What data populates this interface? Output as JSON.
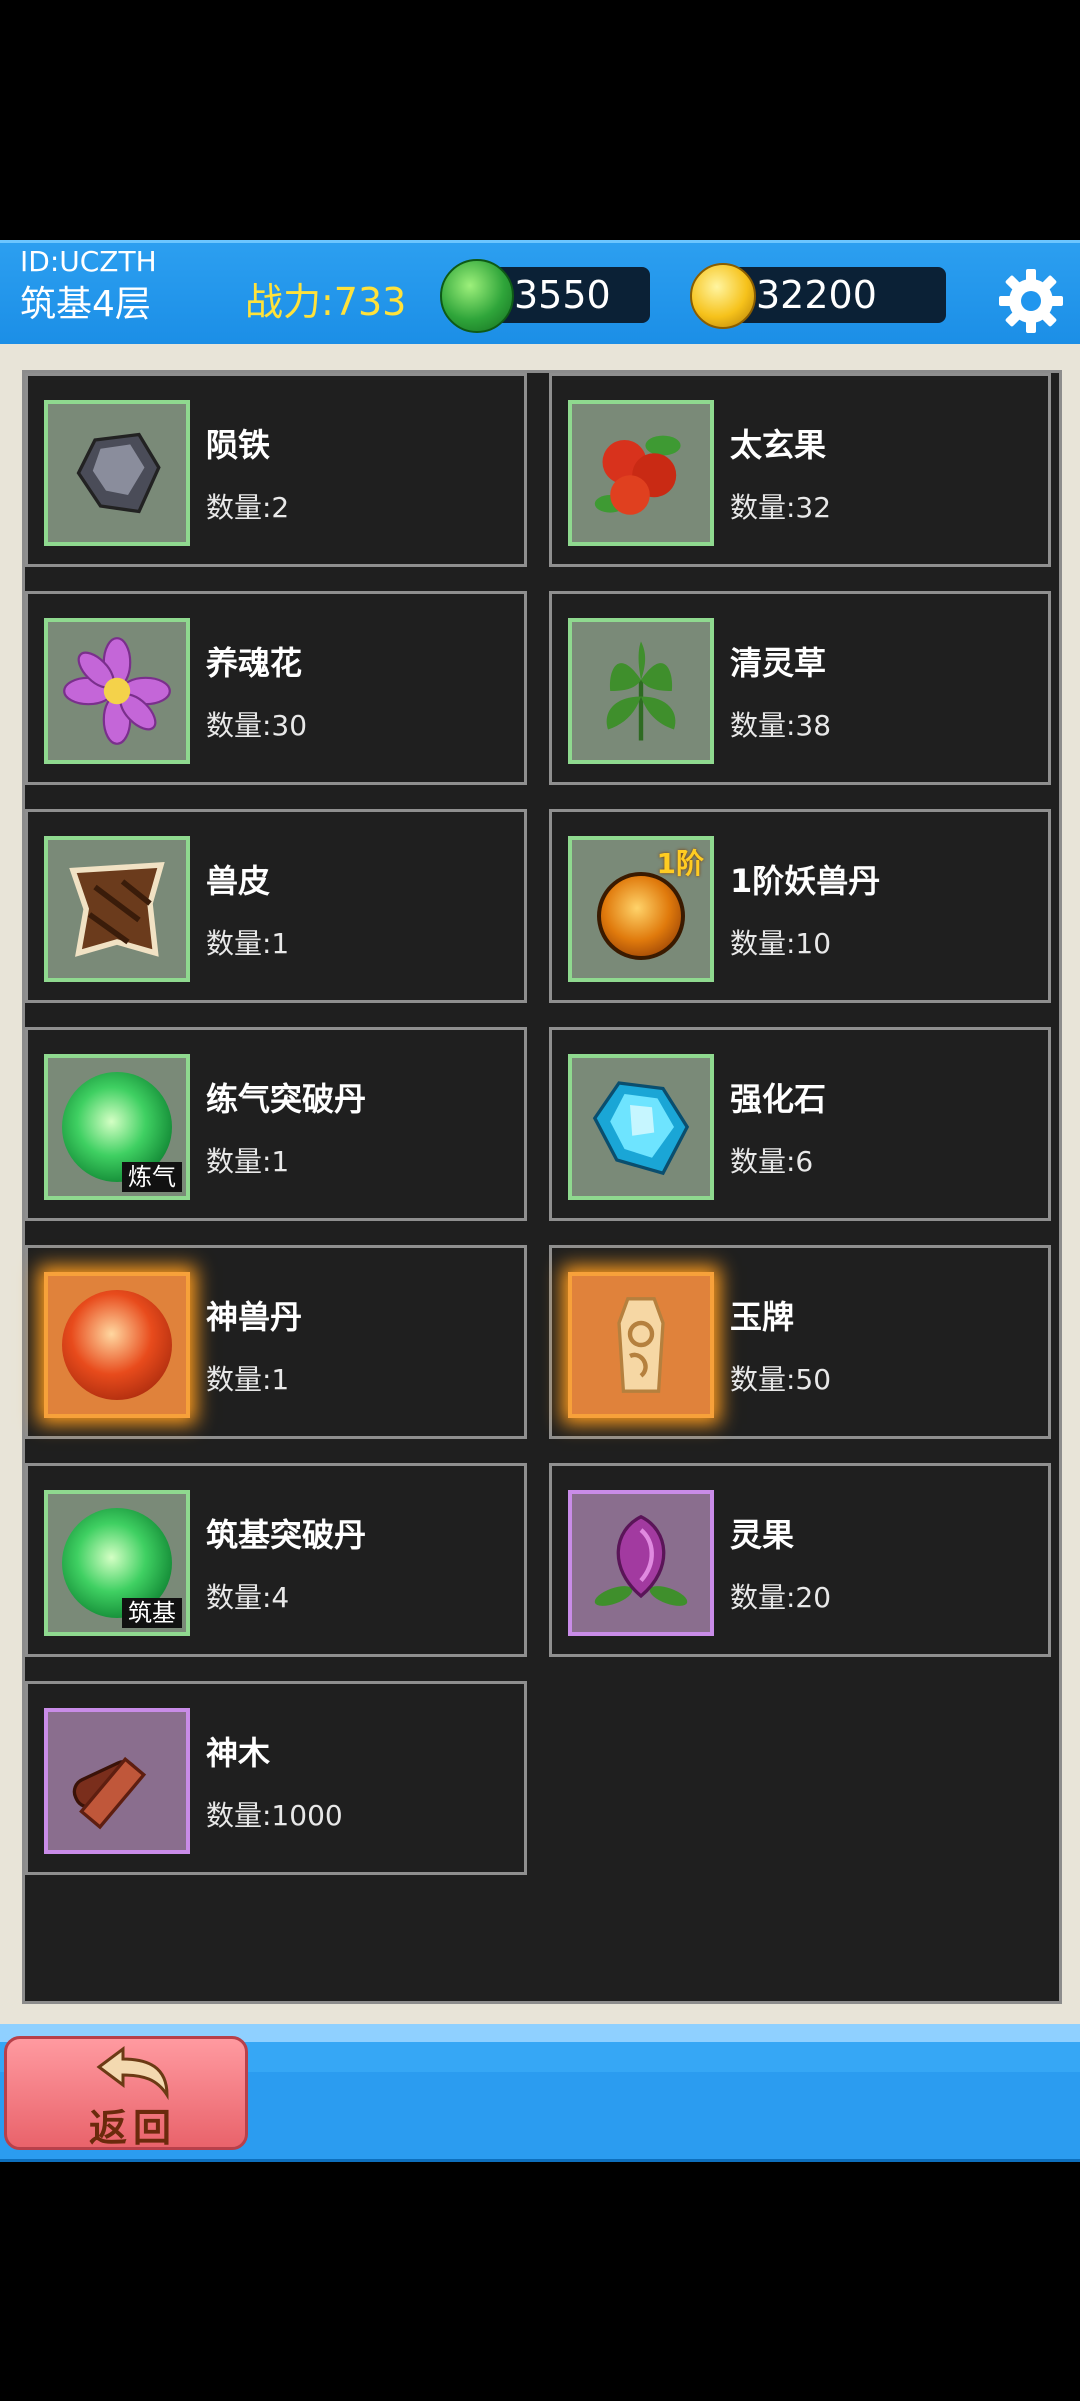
{
  "header": {
    "player_id": "ID:UCZTH",
    "realm": "筑基4层",
    "power": "战力:733",
    "jade": "3550",
    "gold": "32200",
    "icons": {
      "jade": "jade-coin-icon",
      "gold": "gold-coin-icon",
      "settings": "gear-icon"
    }
  },
  "items": [
    {
      "name": "陨铁",
      "qty": "数量:2",
      "icon": "meteor-iron-icon",
      "rarity": "green"
    },
    {
      "name": "太玄果",
      "qty": "数量:32",
      "icon": "red-berry-icon",
      "rarity": "green"
    },
    {
      "name": "养魂花",
      "qty": "数量:30",
      "icon": "purple-flower-icon",
      "rarity": "green"
    },
    {
      "name": "清灵草",
      "qty": "数量:38",
      "icon": "herb-leaf-icon",
      "rarity": "green"
    },
    {
      "name": "兽皮",
      "qty": "数量:1",
      "icon": "beast-hide-icon",
      "rarity": "green"
    },
    {
      "name": "1阶妖兽丹",
      "qty": "数量:10",
      "icon": "beast-core-icon",
      "rarity": "green",
      "badge": "1阶"
    },
    {
      "name": "练气突破丹",
      "qty": "数量:1",
      "icon": "green-pill-icon",
      "rarity": "green",
      "tag": "炼气"
    },
    {
      "name": "强化石",
      "qty": "数量:6",
      "icon": "blue-crystal-icon",
      "rarity": "green"
    },
    {
      "name": "神兽丹",
      "qty": "数量:1",
      "icon": "fire-pill-icon",
      "rarity": "orange"
    },
    {
      "name": "玉牌",
      "qty": "数量:50",
      "icon": "jade-token-icon",
      "rarity": "orange"
    },
    {
      "name": "筑基突破丹",
      "qty": "数量:4",
      "icon": "green-pill-icon",
      "rarity": "green",
      "tag": "筑基"
    },
    {
      "name": "灵果",
      "qty": "数量:20",
      "icon": "purple-fruit-icon",
      "rarity": "purple"
    },
    {
      "name": "神木",
      "qty": "数量:1000",
      "icon": "divine-wood-icon",
      "rarity": "purple"
    }
  ],
  "footer": {
    "back_label": "返回",
    "back_icon": "back-arrow-icon"
  }
}
